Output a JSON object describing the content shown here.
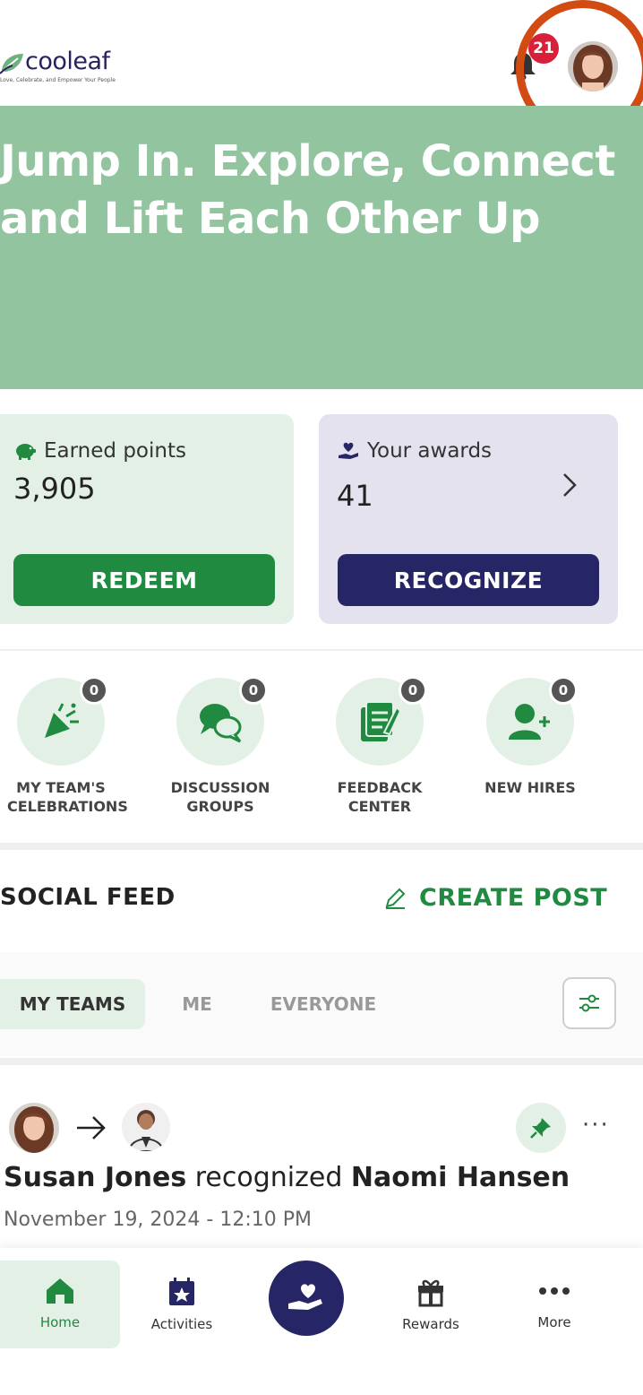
{
  "header": {
    "logo_word": "cooleaf",
    "logo_tagline": "Love, Celebrate, and Empower Your People",
    "notification_count": "21"
  },
  "hero": {
    "title": "Jump In. Explore, Connect and Lift Each Other Up"
  },
  "stats": {
    "points": {
      "label": "Earned points",
      "value": "3,905",
      "button": "REDEEM"
    },
    "awards": {
      "label": "Your awards",
      "value": "41",
      "button": "RECOGNIZE"
    }
  },
  "quick_links": [
    {
      "label": "MY TEAM'S CELEBRATIONS",
      "count": "0"
    },
    {
      "label": "DISCUSSION GROUPS",
      "count": "0"
    },
    {
      "label": "FEEDBACK CENTER",
      "count": "0"
    },
    {
      "label": "NEW HIRES",
      "count": "0"
    }
  ],
  "feed": {
    "title": "SOCIAL FEED",
    "create_post": "CREATE POST",
    "tabs": [
      "MY TEAMS",
      "ME",
      "EVERYONE"
    ],
    "active_tab": "MY TEAMS"
  },
  "post": {
    "sender": "Susan Jones",
    "verb": "recognized",
    "recipient": "Naomi Hansen",
    "date": "November 19, 2024 - 12:10 PM"
  },
  "nav": {
    "home": "Home",
    "activities": "Activities",
    "rewards": "Rewards",
    "more": "More"
  },
  "colors": {
    "brand_green": "#1f8a40",
    "brand_navy": "#262566",
    "hero_green": "#92c49f",
    "card_green": "#e3f0e6",
    "card_lavender": "#e3e2ee",
    "badge_red": "#d8203a",
    "highlight_ring": "#d24b12"
  },
  "icons": [
    "leaf-logo-icon",
    "bell-icon",
    "piggy-bank-icon",
    "hand-heart-icon",
    "chevron-right-icon",
    "party-popper-icon",
    "chat-bubbles-icon",
    "feedback-icon",
    "add-user-icon",
    "pencil-icon",
    "sliders-icon",
    "arrow-right-icon",
    "pin-icon",
    "home-icon",
    "calendar-star-icon",
    "gift-icon",
    "dots-icon"
  ]
}
